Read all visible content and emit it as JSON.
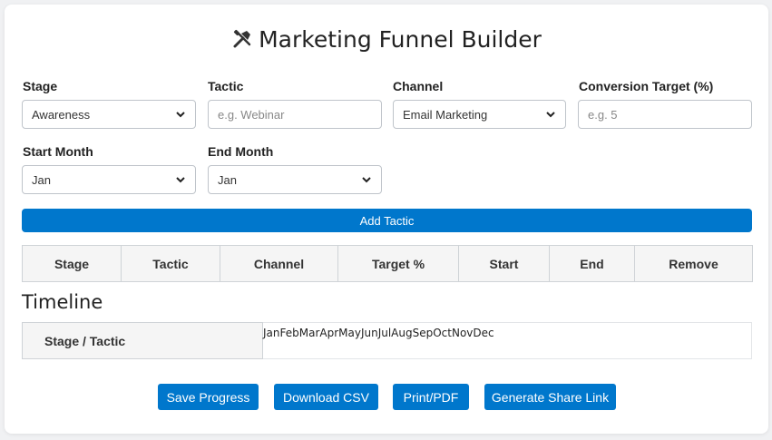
{
  "header": {
    "title": "Marketing Funnel Builder",
    "icon": "tools-icon"
  },
  "form": {
    "stage": {
      "label": "Stage",
      "value": "Awareness"
    },
    "tactic": {
      "label": "Tactic",
      "placeholder": "e.g. Webinar"
    },
    "channel": {
      "label": "Channel",
      "value": "Email Marketing"
    },
    "target": {
      "label": "Conversion Target (%)",
      "placeholder": "e.g. 5"
    },
    "start": {
      "label": "Start Month",
      "value": "Jan"
    },
    "end": {
      "label": "End Month",
      "value": "Jan"
    },
    "add_label": "Add Tactic"
  },
  "table": {
    "columns": [
      "Stage",
      "Tactic",
      "Channel",
      "Target %",
      "Start",
      "End",
      "Remove"
    ]
  },
  "timeline": {
    "heading": "Timeline",
    "row_header": "Stage / Tactic",
    "months": "JanFebMarAprMayJunJulAugSepOctNovDec"
  },
  "actions": {
    "save": "Save Progress",
    "download": "Download CSV",
    "print": "Print/PDF",
    "share": "Generate Share Link"
  },
  "colors": {
    "accent": "#0077cc"
  }
}
